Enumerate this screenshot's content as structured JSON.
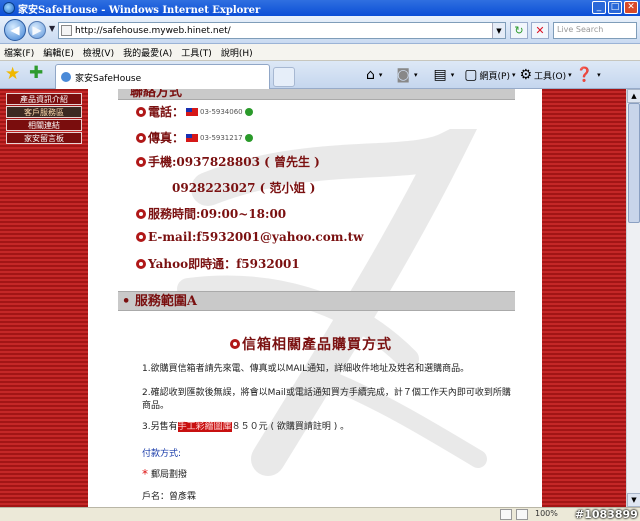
{
  "window": {
    "title": "家安SafeHouse - Windows Internet Explorer"
  },
  "address_bar": {
    "url": "http://safehouse.myweb.hinet.net/",
    "search_placeholder": "Live Search"
  },
  "menu": [
    "檔案(F)",
    "編輯(E)",
    "檢視(V)",
    "我的最愛(A)",
    "工具(T)",
    "說明(H)"
  ],
  "tab": {
    "title": "家安SafeHouse"
  },
  "toolbar": {
    "page_label": "網頁(P)",
    "tools_label": "工具(O)"
  },
  "sidebar": {
    "items": [
      {
        "label": "產品資訊介紹",
        "active": false
      },
      {
        "label": "客戶服務區",
        "active": true
      },
      {
        "label": "相關連結",
        "active": false
      },
      {
        "label": "家安留言板",
        "active": false
      }
    ]
  },
  "contact": {
    "header_partial": "聯絡方式",
    "phone_label": "電話：",
    "phone_number": "03-5934060",
    "fax_label": "傳真：",
    "fax_number": "03-5931217",
    "mobile1": "手機:0937828803 ( 曾先生 )",
    "mobile2": "0928223027 ( 范小姐 )",
    "hours": "服務時間:09:00~18:00",
    "email": "E-mail:f5932001@yahoo.com.tw",
    "yahoo": "Yahoo即時通：f5932001"
  },
  "service": {
    "section_title": "服務範圍A",
    "subtitle": "信箱相關產品購買方式",
    "para1": "1.欲購買信箱者請先來電、傳真或以MAIL通知，詳細收件地址及姓名和選購商品。",
    "para2": "2.確認收到匯款後無誤，將會以Mail或電話通知買方手續完成，計７個工作天內即可收到所購商品。",
    "para3_pre": "3.另售有",
    "para3_highlight": "手工彩繪圖庫",
    "para3_post": "８５０元 ( 欲購買請註明 ) 。",
    "payment_label": "付款方式:",
    "postal": "郵局劃撥",
    "account": "戶名：曾彥霖"
  },
  "status": {
    "zoom": "100%",
    "watermark": "#1083899"
  },
  "colors": {
    "brand_red": "#7a1010",
    "stripe_red": "#c42727",
    "link_blue": "#1a3caa"
  }
}
